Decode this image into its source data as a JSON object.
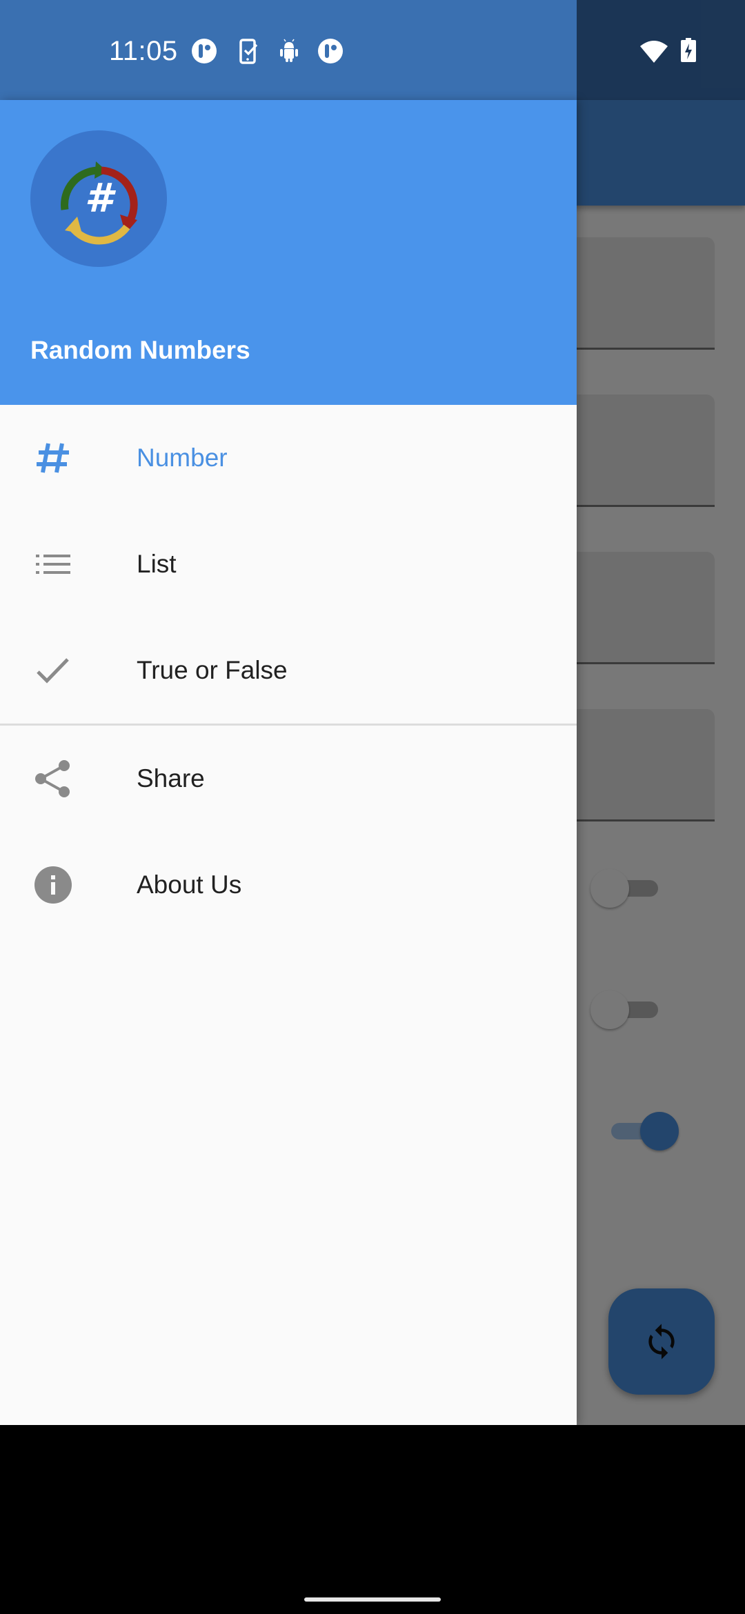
{
  "status_bar": {
    "time": "11:05",
    "notification_icons": [
      "p-app-icon",
      "phone-check-icon",
      "android-icon",
      "p-app-icon"
    ],
    "system_icons": [
      "wifi-icon",
      "battery-charging-icon"
    ]
  },
  "drawer": {
    "header": {
      "app_name": "Random Numbers",
      "logo": "random-numbers-logo"
    },
    "primary_items": [
      {
        "label": "Number",
        "icon": "hash-icon",
        "active": true
      },
      {
        "label": "List",
        "icon": "list-icon",
        "active": false
      },
      {
        "label": "True or False",
        "icon": "check-icon",
        "active": false
      }
    ],
    "secondary_items": [
      {
        "label": "Share",
        "icon": "share-icon"
      },
      {
        "label": "About Us",
        "icon": "info-icon"
      }
    ]
  },
  "background_app": {
    "switches": [
      {
        "state": "off"
      },
      {
        "state": "off"
      },
      {
        "state": "on"
      }
    ],
    "fab_icon": "refresh-icon"
  },
  "colors": {
    "primary": "#4a90e2",
    "status_bar": "#3a70b1",
    "active_item": "#4a90e2",
    "icon_gray": "#8a8a8a",
    "text": "#212121"
  }
}
